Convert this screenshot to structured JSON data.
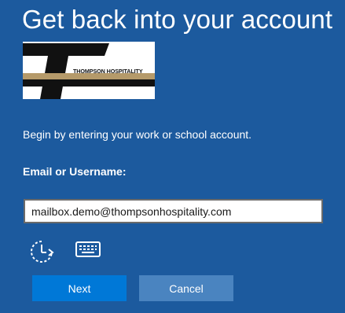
{
  "header": {
    "title": "Get back into your account"
  },
  "logo": {
    "text": "THOMPSON HOSPITALITY"
  },
  "form": {
    "intro": "Begin by entering your work or school account.",
    "email_label": "Email or Username:",
    "email_value": "mailbox.demo@thompsonhospitality.com"
  },
  "tools": {
    "accessibility_icon": "ease-of-access-icon",
    "keyboard_icon": "on-screen-keyboard-icon"
  },
  "actions": {
    "next_label": "Next",
    "cancel_label": "Cancel"
  },
  "colors": {
    "background": "#1c5a9e",
    "primary_button": "#0078d7",
    "secondary_button": "#4a84c0",
    "logo_gold": "#b59a6a"
  }
}
